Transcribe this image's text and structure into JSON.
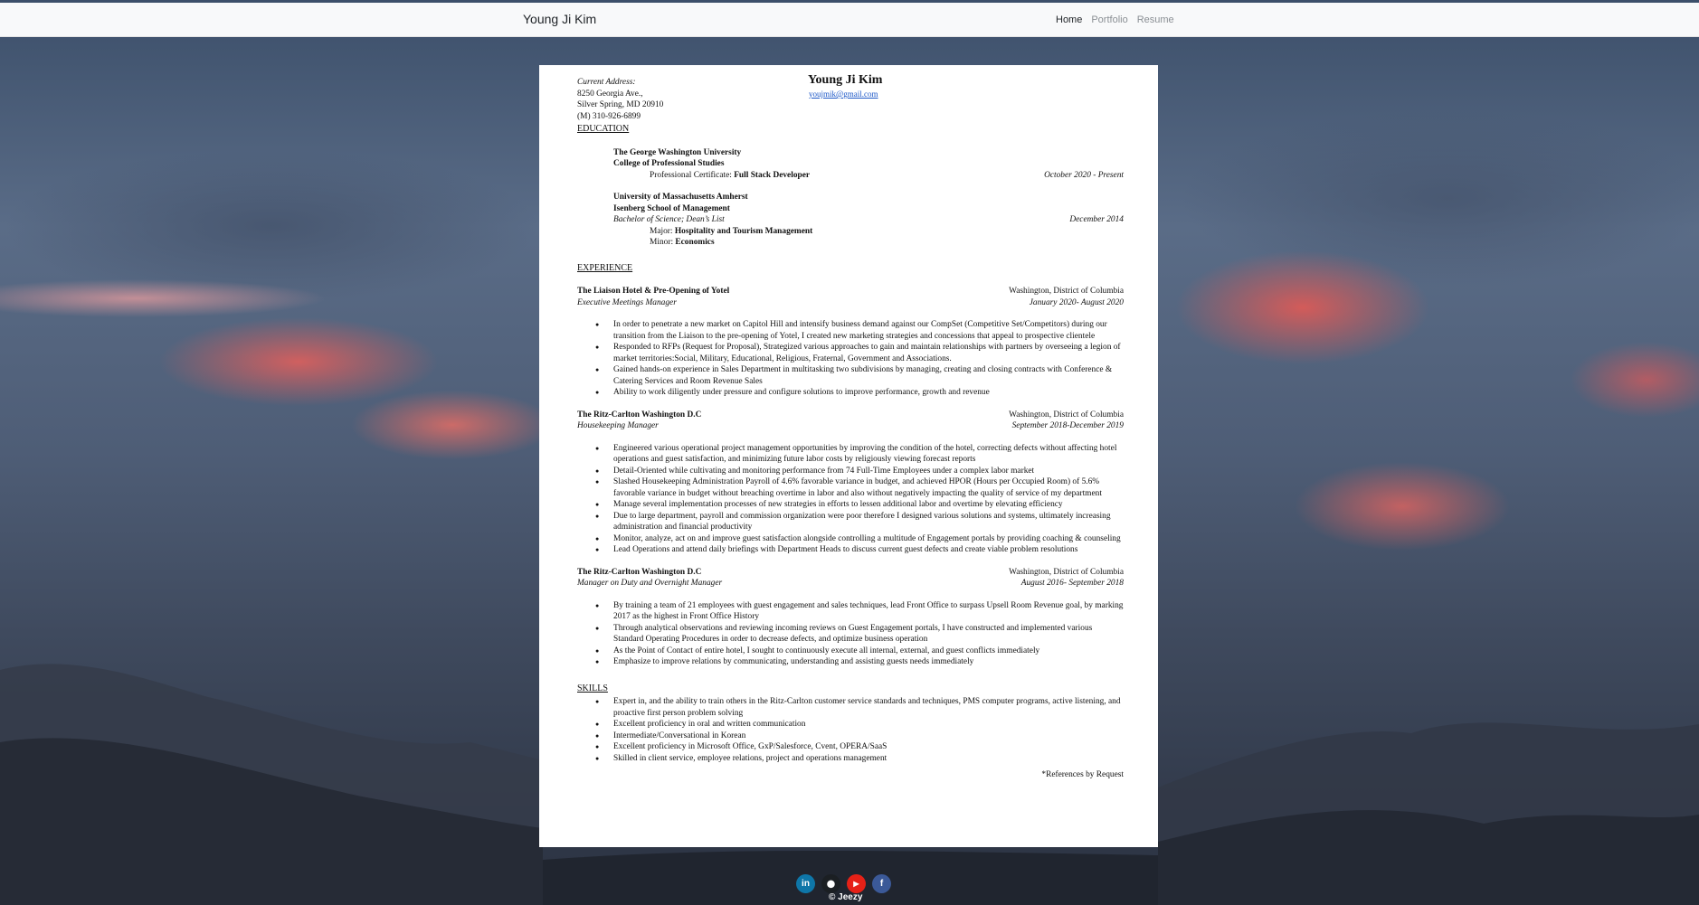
{
  "navbar": {
    "brand": "Young Ji Kim",
    "links": [
      "Home",
      "Portfolio",
      "Resume"
    ]
  },
  "resume": {
    "address_label": "Current Address:",
    "address_lines": [
      "8250 Georgia Ave.,",
      "Silver Spring, MD 20910",
      "(M) 310-926-6899"
    ],
    "name": "Young Ji Kim",
    "email": "youjmik@gmail.com",
    "education_heading": "EDUCATION",
    "edu1": {
      "school": "The George Washington University",
      "college": "College of Professional Studies",
      "cert_prefix": "Professional Certificate: ",
      "cert": "Full Stack Developer",
      "date": "October 2020 - Present"
    },
    "edu2": {
      "school": "University of Massachusetts Amherst",
      "college": "Isenberg School of Management",
      "degree": "Bachelor of Science; Dean’s List",
      "date": "December 2014",
      "major_prefix": "Major: ",
      "major": "Hospitality and Tourism Management",
      "minor_prefix": "Minor: ",
      "minor": "Economics"
    },
    "experience_heading": "EXPERIENCE",
    "jobs": [
      {
        "company": "The Liaison Hotel & Pre-Opening of Yotel",
        "location": "Washington, District of Columbia",
        "title": "Executive Meetings Manager",
        "dates": "January 2020- August 2020",
        "bullets": [
          "In order to penetrate a new market on Capitol Hill and intensify business demand against our CompSet (Competitive Set/Competitors) during our transition from the Liaison to the pre-opening of Yotel,  I created new marketing strategies and concessions that appeal to prospective clientele",
          "Responded to RFPs (Request for Proposal), Strategized various approaches to gain and maintain relationships with partners by overseeing a legion of market territories:Social, Military, Educational, Religious, Fraternal, Government and Associations.",
          "Gained hands-on experience in Sales Department in multitasking two subdivisions by managing, creating and closing contracts with Conference & Catering Services and Room Revenue Sales",
          "Ability to work diligently under pressure and configure solutions to improve performance, growth and revenue"
        ]
      },
      {
        "company": "The Ritz-Carlton Washington D.C",
        "location": "Washington, District of Columbia",
        "title": "Housekeeping Manager",
        "dates": "September 2018-December 2019",
        "bullets": [
          "Engineered various operational project management opportunities by improving the condition of the hotel, correcting defects without affecting hotel operations and guest satisfaction, and minimizing future labor costs by religiously viewing forecast reports",
          "Detail-Oriented while cultivating and monitoring performance from 74 Full-Time Employees under a complex labor market",
          "Slashed Housekeeping Administration Payroll of 4.6% favorable variance in budget, and achieved HPOR (Hours per Occupied Room) of 5.6% favorable variance in budget without breaching overtime in labor and also without negatively impacting the quality of service of my department",
          "Manage several implementation processes of new strategies in efforts to lessen additional labor and overtime by elevating efficiency",
          "Due to large department, payroll and commission organization were poor therefore I designed various solutions and systems, ultimately increasing administration and financial productivity",
          "Monitor, analyze, act on and improve guest satisfaction alongside controlling a multitude of Engagement portals by providing coaching & counseling",
          "Lead Operations and attend daily briefings with Department Heads to discuss current guest defects and create viable problem resolutions"
        ]
      },
      {
        "company": "The Ritz-Carlton Washington D.C",
        "location": "Washington, District of Columbia",
        "title": "Manager on Duty and Overnight Manager",
        "dates": "August 2016- September 2018",
        "bullets": [
          "By training a team of 21 employees with guest engagement and sales techniques, lead Front Office to surpass Upsell Room Revenue goal, by marking 2017 as the highest in Front Office History",
          "Through analytical observations and reviewing incoming reviews on Guest Engagement portals, I have constructed and implemented various Standard Operating Procedures in order to decrease defects, and optimize business operation",
          "As the Point of Contact of entire hotel, I sought to continuously execute all internal, external, and guest conflicts immediately",
          "Emphasize to improve relations by communicating, understanding and assisting guests needs immediately"
        ]
      }
    ],
    "skills_heading": "SKILLS",
    "skills": [
      "Expert in, and the ability to train others in the Ritz-Carlton customer service standards and techniques, PMS computer programs, active listening, and proactive first person problem solving",
      "Excellent proficiency in oral and written communication",
      "Intermediate/Conversational in Korean",
      "Excellent proficiency in Microsoft Office, GxP/Salesforce, Cvent, OPERA/SaaS",
      "Skilled in client service, employee relations, project and operations management"
    ],
    "references": "*References by Request"
  },
  "footer": {
    "social": [
      {
        "label": "in",
        "icon": "linkedin-icon",
        "color": "#0e76a8"
      },
      {
        "label": "⬤",
        "icon": "github-icon",
        "color": "#1b1f23"
      },
      {
        "label": "▶",
        "icon": "youtube-icon",
        "color": "#e62117"
      },
      {
        "label": "f",
        "icon": "facebook-icon",
        "color": "#3b5998"
      }
    ],
    "copyright": "© Jeezy"
  }
}
